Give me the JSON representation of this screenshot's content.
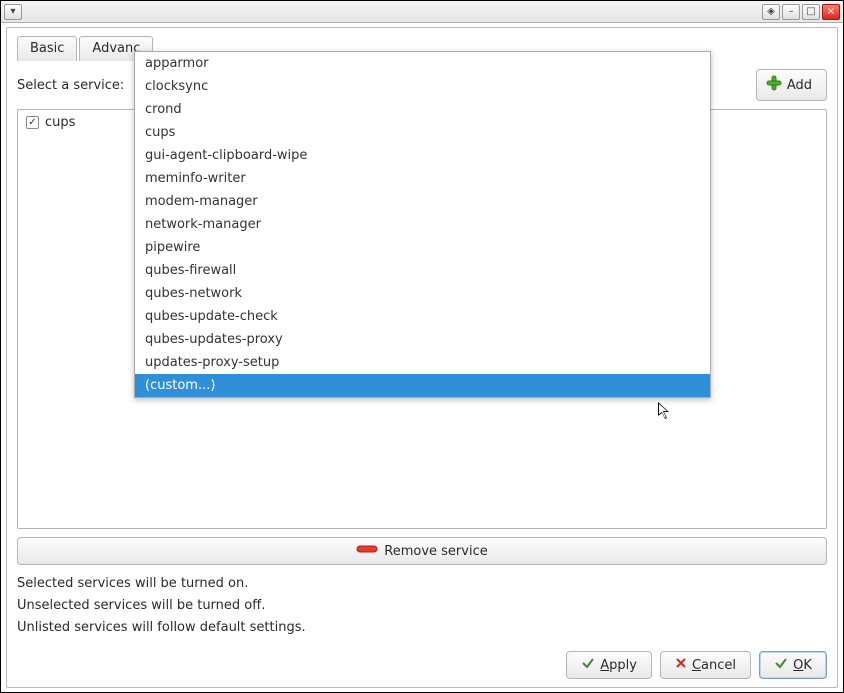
{
  "titlebar": {
    "left_icon": "▾",
    "right_icons": [
      "◈",
      "–",
      "□"
    ],
    "close_icon": "×"
  },
  "tabs": [
    {
      "label": "Basic"
    },
    {
      "label": "Advanc"
    }
  ],
  "select": {
    "label": "Select a service:",
    "add_label": "Add"
  },
  "dropdown": {
    "items": [
      "apparmor",
      "clocksync",
      "crond",
      "cups",
      "gui-agent-clipboard-wipe",
      "meminfo-writer",
      "modem-manager",
      "network-manager",
      "pipewire",
      "qubes-firewall",
      "qubes-network",
      "qubes-update-check",
      "qubes-updates-proxy",
      "updates-proxy-setup",
      "(custom...)"
    ],
    "selected_index": 14
  },
  "list": {
    "items": [
      {
        "checked": true,
        "label": "cups"
      }
    ]
  },
  "remove_label": "Remove service",
  "help": {
    "line1": "Selected services will be turned on.",
    "line2": "Unselected services will be turned off.",
    "line3": "Unlisted services will follow default settings."
  },
  "footer": {
    "apply": {
      "pre": "",
      "mn": "A",
      "post": "pply"
    },
    "cancel": {
      "pre": "",
      "mn": "C",
      "post": "ancel"
    },
    "ok": {
      "pre": "",
      "mn": "O",
      "post": "K"
    }
  }
}
